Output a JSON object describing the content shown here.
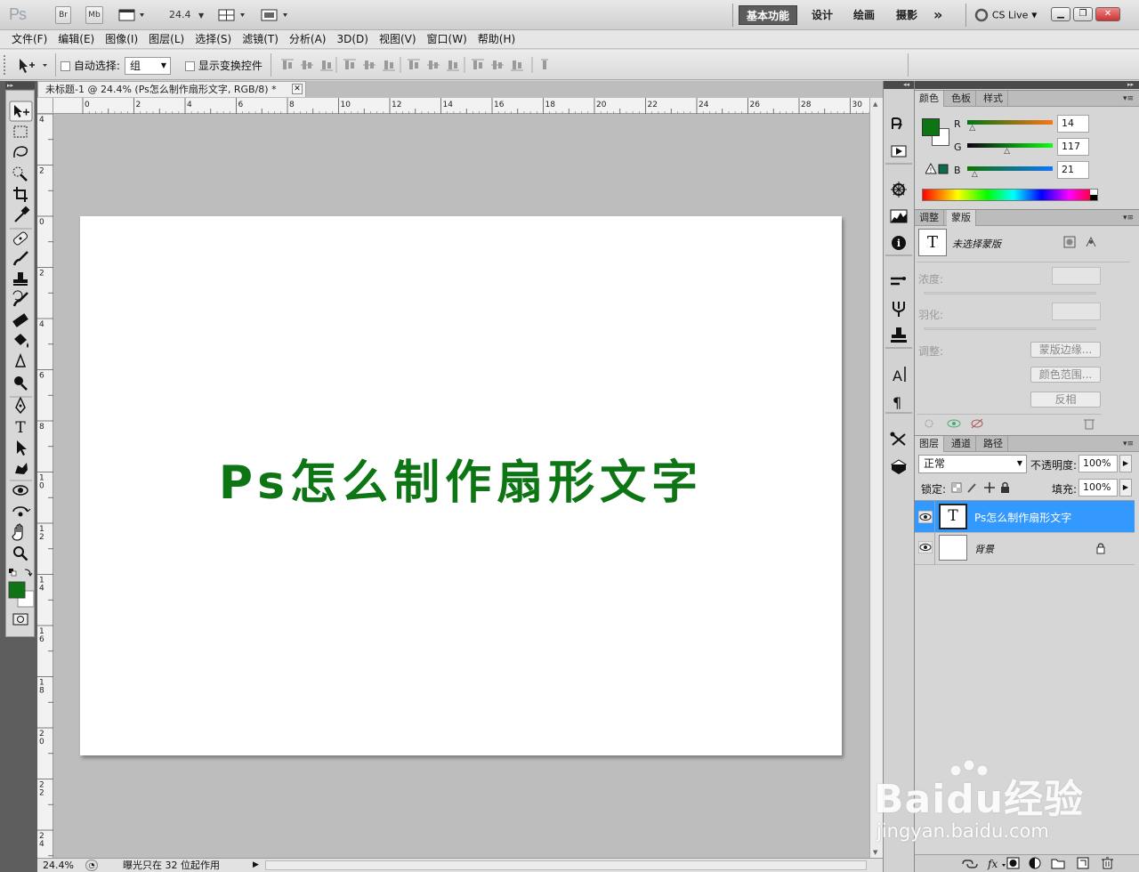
{
  "app": {
    "logo": "Ps",
    "bridge_label": "Br",
    "minibridge_label": "Mb",
    "zoom_value": "24.4",
    "workspaces": [
      "基本功能",
      "设计",
      "绘画",
      "摄影"
    ],
    "more_label": "»",
    "cslive_label": "CS Live"
  },
  "menu": [
    "文件(F)",
    "编辑(E)",
    "图像(I)",
    "图层(L)",
    "选择(S)",
    "滤镜(T)",
    "分析(A)",
    "3D(D)",
    "视图(V)",
    "窗口(W)",
    "帮助(H)"
  ],
  "options": {
    "auto_select_label": "自动选择:",
    "auto_select_value": "组",
    "show_transform_label": "显示变换控件"
  },
  "document": {
    "tab_title": "未标题-1 @ 24.4% (Ps怎么制作扇形文字, RGB/8) *",
    "canvas_text": "Ps怎么制作扇形文字",
    "canvas_text_color": "#0e7515",
    "h_ruler_labels": [
      "0",
      "2",
      "4",
      "6",
      "8",
      "10",
      "12",
      "14",
      "16",
      "18",
      "20",
      "22",
      "24",
      "26",
      "28",
      "30"
    ],
    "v_ruler_labels": [
      "4",
      "2",
      "0",
      "2",
      "4",
      "6",
      "8",
      "10",
      "12",
      "14",
      "16",
      "18",
      "20",
      "22",
      "24"
    ],
    "status_zoom": "24.4%",
    "status_text": "曝光只在 32 位起作用"
  },
  "color_panel": {
    "tabs": [
      "颜色",
      "色板",
      "样式"
    ],
    "foreground": "#0e7515",
    "channels": [
      {
        "label": "R",
        "value": "14",
        "level": 0.055
      },
      {
        "label": "G",
        "value": "117",
        "level": 0.459
      },
      {
        "label": "B",
        "value": "21",
        "level": 0.082
      }
    ]
  },
  "mask_panel": {
    "tabs": [
      "调整",
      "蒙版"
    ],
    "status": "未选择蒙版",
    "density_label": "浓度:",
    "feather_label": "羽化:",
    "refine_label": "调整:",
    "buttons": [
      "蒙版边缘...",
      "颜色范围...",
      "反相"
    ]
  },
  "layers_panel": {
    "tabs": [
      "图层",
      "通道",
      "路径"
    ],
    "blend_mode": "正常",
    "opacity_label": "不透明度:",
    "opacity_value": "100%",
    "lock_label": "锁定:",
    "fill_label": "填充:",
    "fill_value": "100%",
    "layers": [
      {
        "name": "Ps怎么制作扇形文字",
        "type": "text",
        "selected": true
      },
      {
        "name": "背景",
        "type": "background",
        "selected": false
      }
    ]
  },
  "watermark": {
    "brand": "Baidu经验",
    "url": "jingyan.baidu.com"
  }
}
